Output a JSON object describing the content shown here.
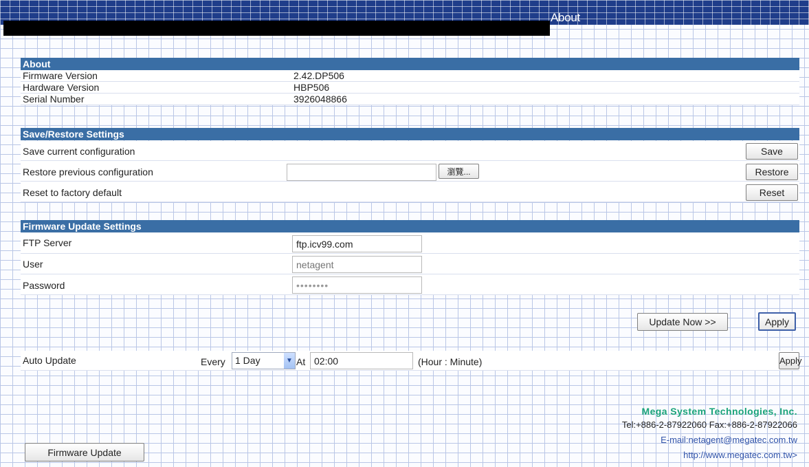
{
  "header": {
    "title": "About"
  },
  "about": {
    "title": "About",
    "rows": [
      {
        "label": "Firmware Version",
        "value": "2.42.DP506"
      },
      {
        "label": "Hardware Version",
        "value": "HBP506"
      },
      {
        "label": "Serial Number",
        "value": "3926048866"
      }
    ]
  },
  "save_restore": {
    "title": "Save/Restore Settings",
    "save_label": "Save current configuration",
    "save_button": "Save",
    "restore_label": "Restore previous configuration",
    "file_input_value": "",
    "browse_button": "瀏覽...",
    "restore_button": "Restore",
    "reset_label": "Reset to factory default",
    "reset_button": "Reset"
  },
  "firmware_update": {
    "title": "Firmware Update Settings",
    "ftp_label": "FTP Server",
    "ftp_value": "ftp.icv99.com",
    "user_label": "User",
    "user_placeholder": "netagent",
    "password_label": "Password",
    "password_value": "••••••••",
    "update_now_button": "Update Now >>",
    "apply_button": "Apply"
  },
  "auto_update": {
    "label": "Auto Update",
    "every_label": "Every",
    "interval_value": "1 Day",
    "at_label": "At",
    "time_value": "02:00",
    "time_hint": "(Hour : Minute)",
    "apply_button": "Apply"
  },
  "footer": {
    "company": "Mega System Technologies, Inc.",
    "phone": "Tel:+886-2-87922060 Fax:+886-2-87922066",
    "email": "E-mail:netagent@megatec.com.tw",
    "website": "http://www.megatec.com.tw>"
  },
  "firmware_update_button": "Firmware Update",
  "colors": {
    "section_header": "#3a6ea5",
    "company": "#1aa37a",
    "banner": "#1f3d8a"
  }
}
